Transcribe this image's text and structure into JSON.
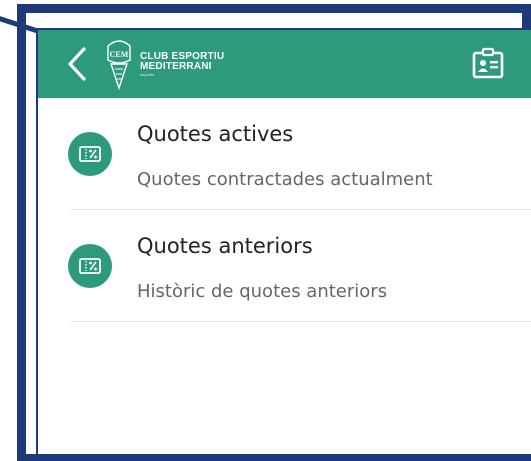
{
  "brand": {
    "line1": "CLUB ESPORTIU",
    "line2": "MEDITERRANI",
    "line3": "esportiu"
  },
  "colors": {
    "primary": "#2e9a7c",
    "frame": "#1f3a78"
  },
  "icons": {
    "back": "chevron-left-icon",
    "card": "id-card-icon",
    "ticket": "ticket-percent-icon"
  },
  "list": {
    "items": [
      {
        "title": "Quotes actives",
        "subtitle": "Quotes contractades actualment"
      },
      {
        "title": "Quotes anteriors",
        "subtitle": "Històric de quotes anteriors"
      }
    ]
  }
}
